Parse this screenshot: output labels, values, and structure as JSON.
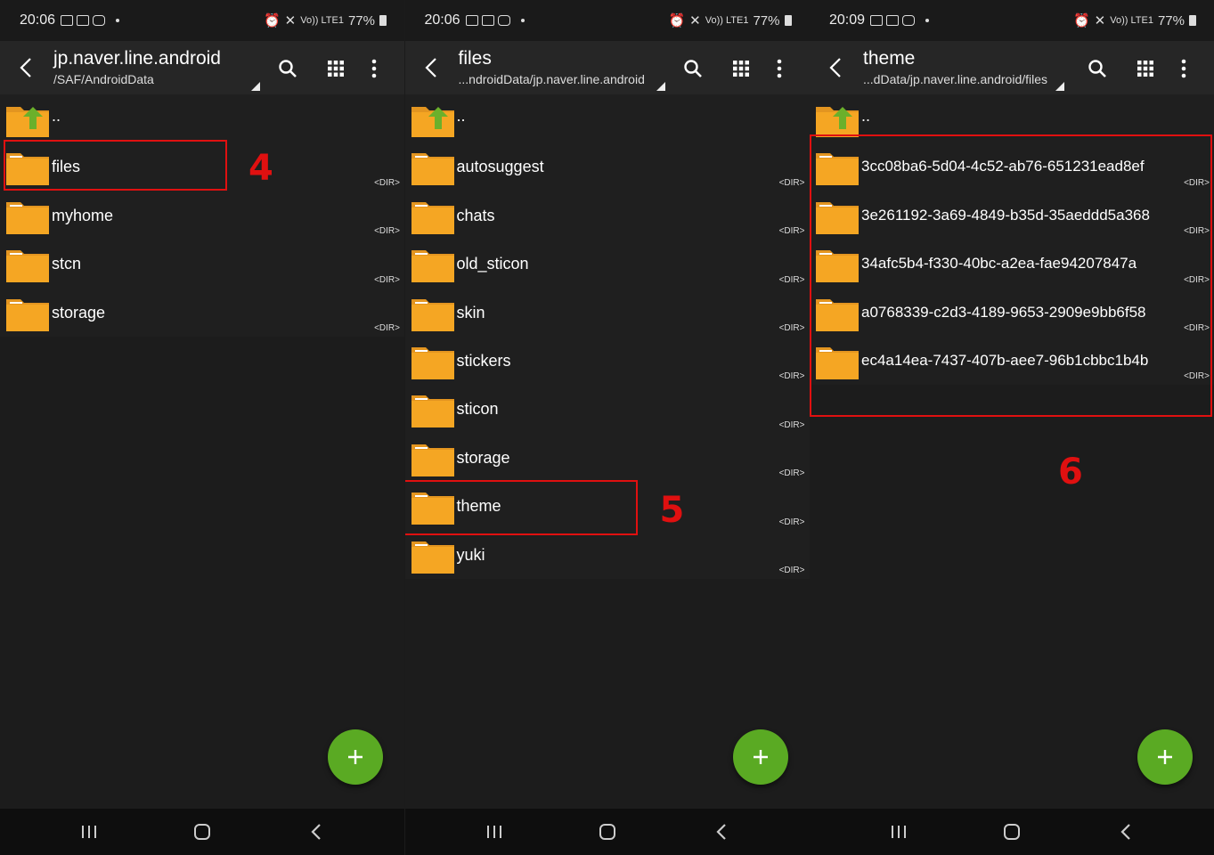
{
  "colors": {
    "accent_fab": "#5aaa23",
    "folder": "#f5a623",
    "highlight": "#e01010",
    "background": "#1c1c1c",
    "appbar": "#262626"
  },
  "screens": [
    {
      "status": {
        "time": "20:06",
        "battery": "77%",
        "signal": "Vo)) LTE1"
      },
      "title": "jp.naver.line.android",
      "path": "/SAF/AndroidData",
      "parent_label": "..",
      "dir_tag": "<DIR>",
      "items": [
        {
          "name": "files"
        },
        {
          "name": "myhome"
        },
        {
          "name": "stcn"
        },
        {
          "name": "storage"
        }
      ],
      "step_label": "4"
    },
    {
      "status": {
        "time": "20:06",
        "battery": "77%",
        "signal": "Vo)) LTE1"
      },
      "title": "files",
      "path": "...ndroidData/jp.naver.line.android",
      "parent_label": "..",
      "dir_tag": "<DIR>",
      "items": [
        {
          "name": "autosuggest"
        },
        {
          "name": "chats"
        },
        {
          "name": "old_sticon"
        },
        {
          "name": "skin"
        },
        {
          "name": "stickers"
        },
        {
          "name": "sticon"
        },
        {
          "name": "storage"
        },
        {
          "name": "theme"
        },
        {
          "name": "yuki"
        }
      ],
      "step_label": "5"
    },
    {
      "status": {
        "time": "20:09",
        "battery": "77%",
        "signal": "Vo)) LTE1"
      },
      "title": "theme",
      "path": "...dData/jp.naver.line.android/files",
      "parent_label": "..",
      "dir_tag": "<DIR>",
      "items": [
        {
          "name": "3cc08ba6-5d04-4c52-ab76-651231ead8ef"
        },
        {
          "name": "3e261192-3a69-4849-b35d-35aeddd5a368"
        },
        {
          "name": "34afc5b4-f330-40bc-a2ea-fae94207847a"
        },
        {
          "name": "a0768339-c2d3-4189-9653-2909e9bb6f58"
        },
        {
          "name": "ec4a14ea-7437-407b-aee7-96b1cbbc1b4b"
        }
      ],
      "step_label": "6"
    }
  ],
  "icons": {
    "back": "back-arrow-icon",
    "search": "search-icon",
    "grid": "grid-view-icon",
    "more": "more-vert-icon",
    "folder": "folder-icon",
    "folder_up": "folder-up-icon",
    "fab": "plus-icon",
    "nav_recents": "recents-icon",
    "nav_home": "home-icon",
    "nav_back": "nav-back-icon"
  }
}
